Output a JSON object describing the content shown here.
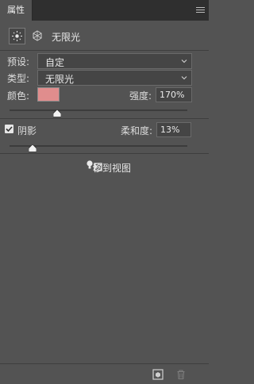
{
  "panel": {
    "tab_label": "属性"
  },
  "header": {
    "title": "无限光"
  },
  "preset": {
    "label": "预设:",
    "value": "自定"
  },
  "type": {
    "label": "类型:",
    "value": "无限光"
  },
  "color": {
    "label": "颜色:",
    "swatch_color": "#e08d8d"
  },
  "intensity": {
    "label": "强度:",
    "value": "170%",
    "slider_fraction": 0.27
  },
  "shadow": {
    "label": "阴影",
    "checked": true,
    "softness_label": "柔和度:",
    "softness_value": "13%",
    "slider_fraction": 0.13
  },
  "move_to_view": {
    "label": "移到视图",
    "icon": "move-to-view-icon"
  },
  "bottom_toolbar": {
    "icons": [
      "render-icon",
      "trash-icon"
    ]
  }
}
